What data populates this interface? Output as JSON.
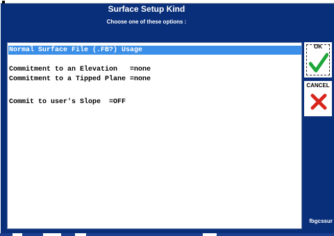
{
  "dialog": {
    "title": "Surface Setup Kind",
    "subtitle": "Choose one of these options :",
    "footer_id": "fbgcssur"
  },
  "options": [
    {
      "label": "Normal Surface File (.FB?) Usage",
      "selected": true
    },
    {
      "label": "",
      "selected": false
    },
    {
      "label": "Commitment to an Elevation   =none",
      "selected": false
    },
    {
      "label": "Commitment to a Tipped Plane =none",
      "selected": false
    },
    {
      "label": "",
      "selected": false
    },
    {
      "label": "Commit to user's Slope  =OFF",
      "selected": false
    }
  ],
  "buttons": {
    "ok_label": "OK",
    "cancel_label": "CANCEL",
    "ok_icon": "checkmark-icon",
    "cancel_icon": "x-icon"
  },
  "colors": {
    "background": "#0a2f7a",
    "selection": "#3b8fe8",
    "ok_green": "#1fa63a",
    "cancel_red": "#d8261c"
  }
}
